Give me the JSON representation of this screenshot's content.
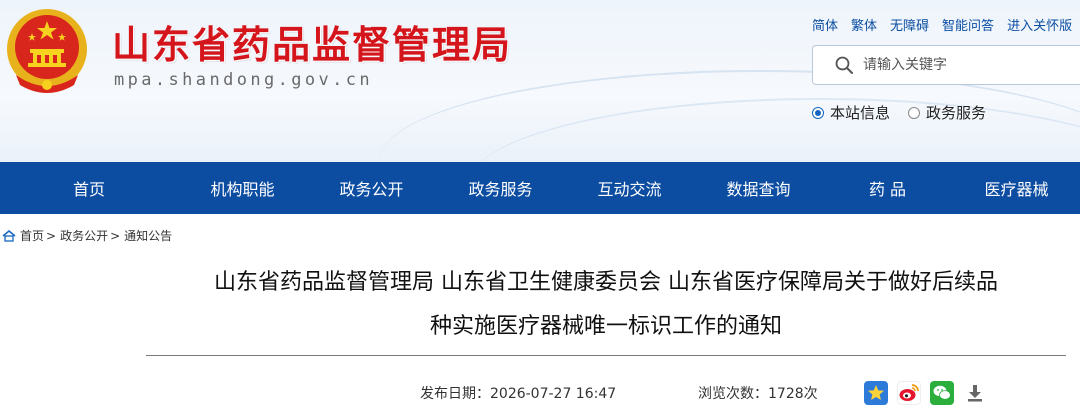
{
  "site": {
    "title": "山东省药品监督管理局",
    "domain": "mpa.shandong.gov.cn"
  },
  "toplinks": [
    "简体",
    "繁体",
    "无障碍",
    "智能问答",
    "进入关怀版"
  ],
  "search": {
    "placeholder": "请输入关键字"
  },
  "scope": {
    "options": [
      {
        "label": "本站信息",
        "selected": true
      },
      {
        "label": "政务服务",
        "selected": false
      }
    ]
  },
  "nav": [
    "首页",
    "机构职能",
    "政务公开",
    "政务服务",
    "互动交流",
    "数据查询",
    "药 品",
    "医疗器械"
  ],
  "breadcrumb": [
    "首页",
    "政务公开",
    "通知公告"
  ],
  "article": {
    "title_line1": "山东省药品监督管理局 山东省卫生健康委员会 山东省医疗保障局关于做好后续品",
    "title_line2": "种实施医疗器械唯一标识工作的通知",
    "date_label": "发布日期：",
    "date": "2026-07-27 16:47",
    "views_label": "浏览次数：",
    "views": "1728次"
  },
  "colors": {
    "brand_red": "#d4151b",
    "nav_blue": "#0c4da2",
    "link_blue": "#0b4ea2"
  },
  "share_icons": [
    "star-icon",
    "weibo-icon",
    "wechat-icon",
    "download-icon"
  ]
}
